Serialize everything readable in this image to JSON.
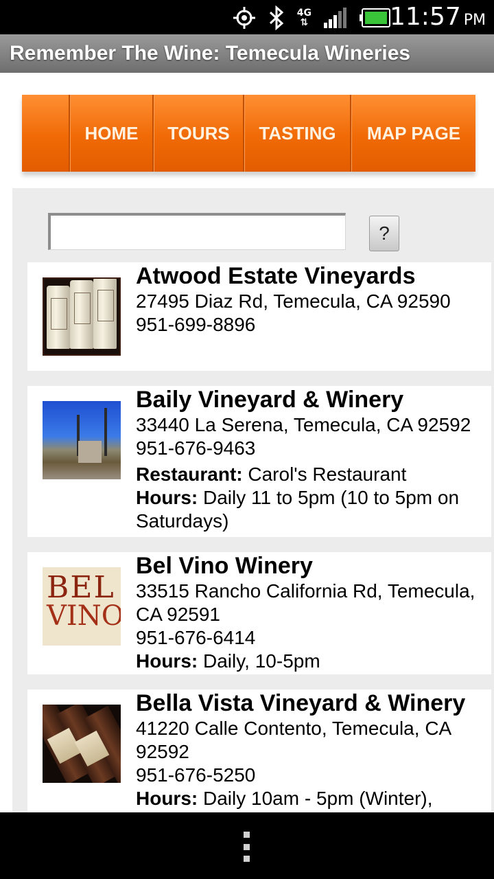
{
  "status_bar": {
    "icons": [
      "gps-icon",
      "bluetooth-icon",
      "network-4g-icon",
      "signal-icon",
      "battery-icon"
    ],
    "network_label": "4G",
    "time": "11:57",
    "ampm": "PM"
  },
  "app": {
    "title": "Remember The Wine: Temecula Wineries"
  },
  "nav": {
    "items": [
      {
        "label": "HOME"
      },
      {
        "label": "TOURS"
      },
      {
        "label": "TASTING"
      },
      {
        "label": "MAP PAGE"
      }
    ],
    "accent": "#f06a06"
  },
  "search": {
    "value": "",
    "placeholder": "",
    "help_label": "?"
  },
  "wineries": [
    {
      "name": "Atwood Estate Vineyards",
      "address": "27495 Diaz Rd, Temecula, CA 92590",
      "phone": "951-699-8896"
    },
    {
      "name": "Baily Vineyard & Winery",
      "address": "33440 La Serena, Temecula, CA 92592",
      "phone": "951-676-9463",
      "restaurant_label": "Restaurant:",
      "restaurant": " Carol's Restaurant",
      "hours_label": "Hours:",
      "hours": " Daily 11 to 5pm (10 to 5pm on Saturdays)"
    },
    {
      "name": "Bel Vino Winery",
      "address": "33515 Rancho California Rd, Temecula, CA 92591",
      "phone": "951-676-6414",
      "hours_label": "Hours:",
      "hours": " Daily, 10-5pm",
      "logo_line1": "BEL",
      "logo_line2": "VINO"
    },
    {
      "name": "Bella Vista Vineyard & Winery",
      "address": "41220 Calle Contento, Temecula, CA 92592",
      "phone": "951-676-5250",
      "hours_label": "Hours:",
      "hours": " Daily 10am - 5pm (Winter),"
    }
  ]
}
